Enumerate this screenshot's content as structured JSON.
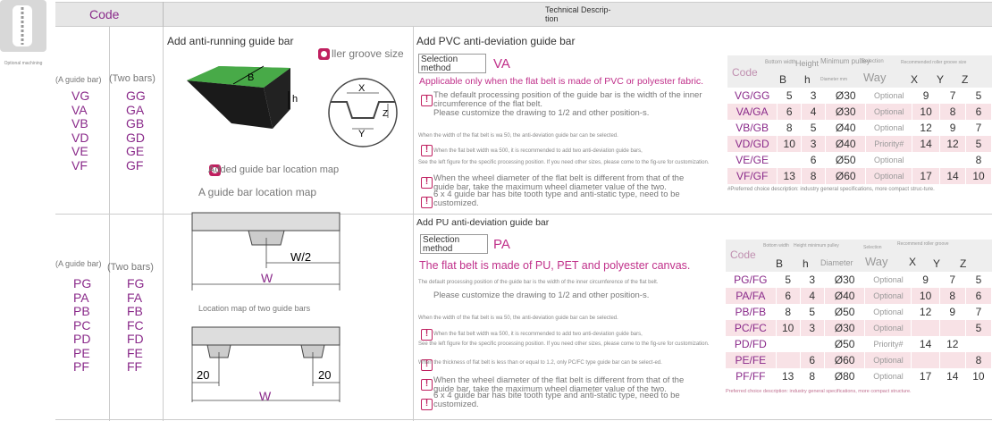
{
  "side": {
    "label": "Optional machining"
  },
  "header": {
    "code": "Code",
    "tech": "Technical Descrip-\ntion"
  },
  "left1": {
    "col1_head": "(A guide bar)",
    "col2_head": "(Two bars)",
    "col1": [
      "VG",
      "VA",
      "VB",
      "VD",
      "VE",
      "VF"
    ],
    "col2": [
      "GG",
      "GA",
      "GB",
      "GD",
      "GE",
      "GF"
    ]
  },
  "left2": {
    "col1_head": "(A guide bar)",
    "col2_head": "(Two bars)",
    "col1": [
      "PG",
      "PA",
      "PB",
      "PC",
      "PD",
      "PE",
      "PF"
    ],
    "col2": [
      "FG",
      "FA",
      "FB",
      "FC",
      "FD",
      "FE",
      "FF"
    ]
  },
  "mid": {
    "anti_running": "Add anti-running guide bar",
    "roller_groove": "ller groove size",
    "b": "B",
    "h": "h",
    "x": "X",
    "y": "Y",
    "z": "Z",
    "added_location": "Added guide bar location map",
    "location_map": "A guide bar location map",
    "w2": "W/2",
    "w": "W",
    "two_bars_map": "Location map of two guide bars",
    "twenty_l": "20",
    "twenty_r": "20",
    "w_b": "W"
  },
  "pvc": {
    "title": "Add PVC anti-deviation guide bar",
    "sel_method": "Selection method",
    "va": "VA",
    "applicable": "Applicable only when the flat belt is made of PVC or polyester fabric.",
    "note1": "The default processing position of the guide bar is the width of the inner circumference of the flat belt.",
    "note1b": "Please customize the drawing to 1/2 and other position-s.",
    "note2": "When the width of the flat belt is wa 50, the anti-deviation guide bar can be selected.",
    "note3": "When the flat belt width wa 500, it is recommended to add two anti-deviation guide bars,",
    "note3b": "See the left figure for the specific processing position. If you need other sizes, please come to the fig-ure for customization.",
    "note4": "When the wheel diameter of the flat belt is different from that of the guide bar, take the maximum wheel diameter value of the two.",
    "note5": "6 x 4 guide bar has bite tooth type and anti-static type, need to be customized.",
    "table": {
      "code": "Code",
      "bw": "Bottom width",
      "height": "Height",
      "min_pulley": "Minimum pulley",
      "dia_mm": "Diameter mm",
      "selection": "Selection",
      "way": "Way",
      "rec": "Recommended roller groove size",
      "B": "B",
      "h": "h",
      "X": "X",
      "Y": "Y",
      "Z": "Z",
      "rows": [
        {
          "code": "VG/GG",
          "b": "5",
          "h": "3",
          "d": "Ø30",
          "way": "Optional",
          "x": "9",
          "y": "7",
          "z": "5"
        },
        {
          "code": "VA/GA",
          "b": "6",
          "h": "4",
          "d": "Ø30",
          "way": "Optional",
          "x": "10",
          "y": "8",
          "z": "6"
        },
        {
          "code": "VB/GB",
          "b": "8",
          "h": "5",
          "d": "Ø40",
          "way": "Optional",
          "x": "12",
          "y": "9",
          "z": "7"
        },
        {
          "code": "VD/GD",
          "b": "10",
          "h": "3",
          "d": "Ø40",
          "way": "Priority#",
          "x": "14",
          "y": "12",
          "z": "5"
        },
        {
          "code": "VE/GE",
          "b": "",
          "h": "6",
          "d": "Ø50",
          "way": "Optional",
          "x": "",
          "y": "",
          "z": "8"
        },
        {
          "code": "VF/GF",
          "b": "13",
          "h": "8",
          "d": "Ø60",
          "way": "Optional",
          "x": "17",
          "y": "14",
          "z": "10"
        }
      ],
      "foot": "#Preferred choice description: industry general specifications, more compact struc-ture."
    }
  },
  "pu": {
    "title": "Add PU anti-deviation guide bar",
    "sel_method": "Selection method",
    "pa": "PA",
    "applicable": "The flat belt is made of PU, PET and polyester canvas.",
    "note1": "The default processing position of the guide bar is the width of the inner circumference of the flat belt.",
    "note1b": "Please customize the drawing to 1/2 and other position-s.",
    "note2": "When the width of the flat belt is wa 50, the anti-deviation guide bar can be selected.",
    "note3": "When the flat belt width wa 500, it is recommended to add two anti-deviation guide bars,",
    "note3b": "See the left figure for the specific processing position. If you need other sizes, please come to the fig-ure for customization.",
    "note4": "When the thickness of flat belt is less than or equal to 1.2, only PC/FC type guide bar can be select-ed.",
    "note5": "When the wheel diameter of the flat belt is different from that of the guide bar, take the maximum wheel diameter value of the two.",
    "note6": "6 x 4 guide bar has bite tooth type and anti-static type, need to be customized.",
    "table": {
      "code": "Code",
      "bw": "Bottom width",
      "height": "Height",
      "min_pulley": "minimum pulley",
      "diameter": "Diameter",
      "selection": "Selection",
      "way": "Way",
      "rec": "Recommend roller groove",
      "B": "B",
      "h": "h",
      "X": "X",
      "Y": "Y",
      "Z": "Z",
      "rows": [
        {
          "code": "PG/FG",
          "b": "5",
          "h": "3",
          "d": "Ø30",
          "way": "Optional",
          "x": "9",
          "y": "7",
          "z": "5"
        },
        {
          "code": "PA/FA",
          "b": "6",
          "h": "4",
          "d": "Ø40",
          "way": "Optional",
          "x": "10",
          "y": "8",
          "z": "6"
        },
        {
          "code": "PB/FB",
          "b": "8",
          "h": "5",
          "d": "Ø50",
          "way": "Optional",
          "x": "12",
          "y": "9",
          "z": "7"
        },
        {
          "code": "PC/FC",
          "b": "10",
          "h": "3",
          "d": "Ø30",
          "way": "Optional",
          "x": "",
          "y": "",
          "z": "5"
        },
        {
          "code": "PD/FD",
          "b": "",
          "h": "",
          "d": "Ø50",
          "way": "Priority#",
          "x": "14",
          "y": "12",
          "z": ""
        },
        {
          "code": "PE/FE",
          "b": "",
          "h": "6",
          "d": "Ø60",
          "way": "Optional",
          "x": "",
          "y": "",
          "z": "8"
        },
        {
          "code": "PF/FF",
          "b": "13",
          "h": "8",
          "d": "Ø80",
          "way": "Optional",
          "x": "17",
          "y": "14",
          "z": "10"
        }
      ],
      "foot": "Preferred choice description: industry general specifications, more compact structure."
    }
  }
}
